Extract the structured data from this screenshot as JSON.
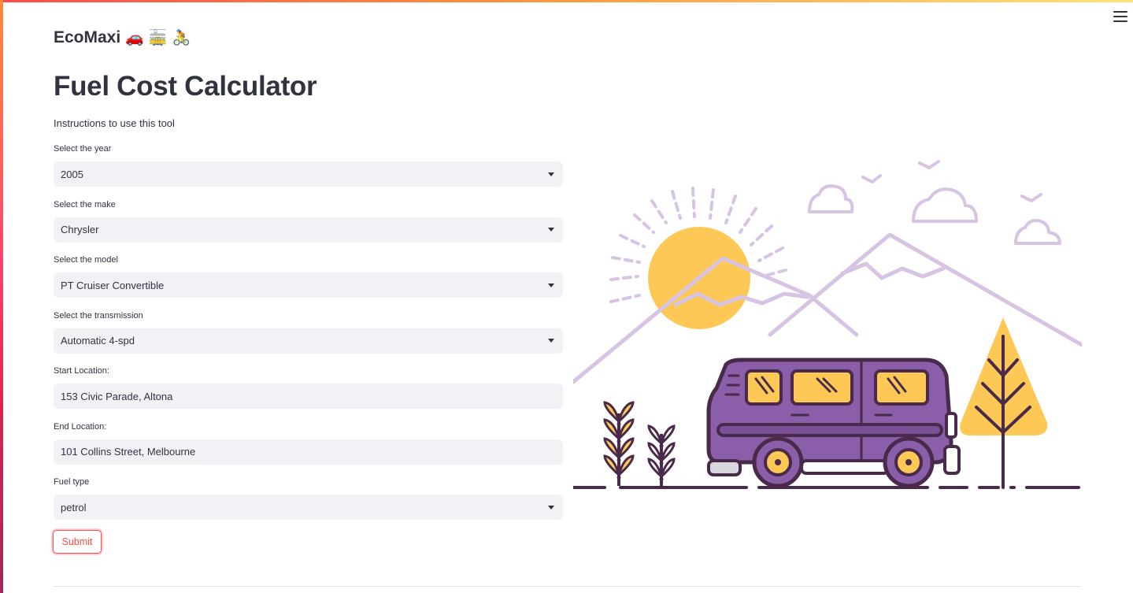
{
  "app": {
    "brand_name": "EcoMaxi",
    "brand_emoji_car": "🚗",
    "brand_emoji_tram": "🚋",
    "brand_emoji_cyclist": "🚴",
    "menu_icon": "hamburger-menu-icon"
  },
  "page": {
    "title": "Fuel Cost Calculator",
    "instructions": "Instructions to use this tool"
  },
  "form": {
    "year": {
      "label": "Select the year",
      "value": "2005"
    },
    "make": {
      "label": "Select the make",
      "value": "Chrysler"
    },
    "model": {
      "label": "Select the model",
      "value": "PT Cruiser Convertible"
    },
    "transmission": {
      "label": "Select the transmission",
      "value": "Automatic 4-spd"
    },
    "start": {
      "label": "Start Location:",
      "value": "153 Civic Parade, Altona"
    },
    "end": {
      "label": "End Location:",
      "value": "101 Collins Street, Melbourne"
    },
    "fuel": {
      "label": "Fuel type",
      "value": "petrol"
    },
    "submit_label": "Submit"
  },
  "colors": {
    "accent": "#ff4b4b",
    "input_bg": "#f0f2f6",
    "text": "#31333f",
    "van_purple": "#8a5ea8",
    "sun_yellow": "#fdc856",
    "outline": "#4a2a4a",
    "mountain_lilac": "#d7c3e3"
  }
}
